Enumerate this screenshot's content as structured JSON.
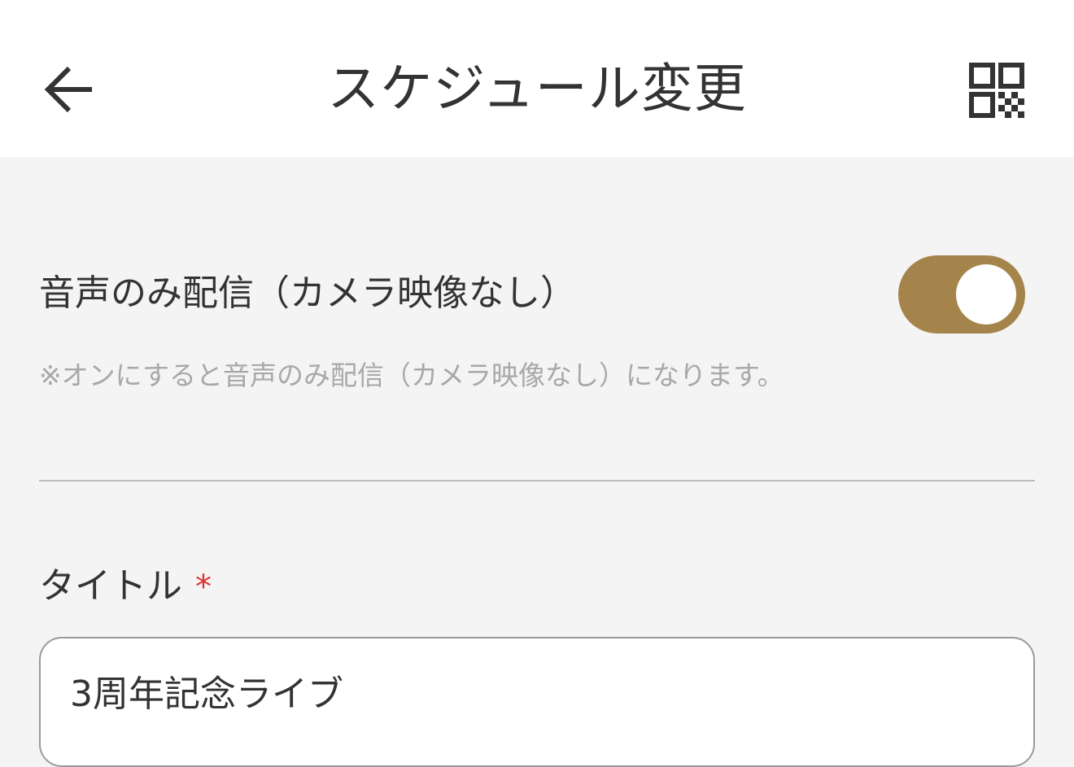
{
  "header": {
    "title": "スケジュール変更",
    "back_icon": "arrow-left-icon",
    "qr_icon": "qr-code-icon"
  },
  "audio_only": {
    "label": "音声のみ配信（カメラ映像なし）",
    "enabled": true,
    "note": "※オンにすると音声のみ配信（カメラ映像なし）になります。"
  },
  "title_field": {
    "label": "タイトル",
    "required_mark": "*",
    "value": "3周年記念ライブ"
  },
  "colors": {
    "toggle_on": "#a4844a",
    "required": "#e03131",
    "text": "#333333",
    "note": "#a8a8a8"
  }
}
